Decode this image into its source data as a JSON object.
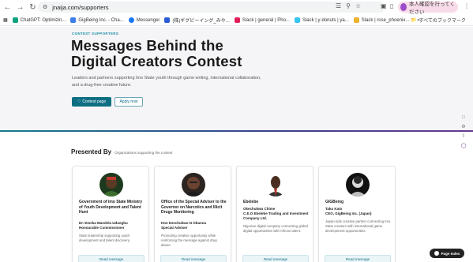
{
  "browser": {
    "url": "jnaija.com/supporters",
    "profile_label": "本人確認を行ってください",
    "bookmarks": [
      {
        "label": "ChatGPT: Optimizin...",
        "color": "#10a37f"
      },
      {
        "label": "GigBeing Inc. - Cha...",
        "color": "#3d7eea"
      },
      {
        "label": "Messenger",
        "color": "#1877f2"
      },
      {
        "label": "(株)ギグビーイング_みや...",
        "color": "#2a5bd7"
      },
      {
        "label": "Slack | general | Pho...",
        "color": "#e01e5a"
      },
      {
        "label": "Slack | y-donuts | ya...",
        "color": "#36c5f0"
      },
      {
        "label": "Slack | rose_phoenix...",
        "color": "#ecb22e"
      }
    ],
    "bookmarks_overflow": "»",
    "all_bookmarks_label": "すべてのブックマーク"
  },
  "hero": {
    "eyebrow": "CONTEST SUPPORTERS",
    "title_line1": "Messages Behind the",
    "title_line2": "Digital Creators Contest",
    "subtitle": "Leaders and partners supporting Imo State youth through game writing, international collaboration, and a drug-free creative future.",
    "primary_button": "Contest page",
    "secondary_button": "Apply now"
  },
  "presented": {
    "heading": "Presented By",
    "subheading": "Organizations supporting the contest"
  },
  "cards": [
    {
      "org": "Government of Imo State Ministry of Youth Development and Talent Hunt",
      "person": "Dr. Emeka Mandela Uduegbu",
      "role": "Honourable Commissioner",
      "desc": "State leadership supporting youth development and talent discovery.",
      "button": "Read message"
    },
    {
      "org": "Office of the Special Adviser to the Governor on Narcotics and Illicit Drugs Monitoring",
      "person": "Hon Ezechukwu N Obanna",
      "role": "Special Adviser",
      "desc": "Promoting creative opportunity while reinforcing the message against drug abuse.",
      "button": "Read message"
    },
    {
      "org": "Ebelebe",
      "person": "Okechukwu Chime",
      "role": "C.E.O Ebelebe Trading and Investment Company Ltd.",
      "desc": "Nigerian digital company connecting global digital opportunities with African talent.",
      "button": "Read message"
    },
    {
      "org": "GIGBeing",
      "person": "Taku Kato",
      "role": "CEO, GigBeing Inc. (Japan)",
      "desc": "Japan-side creative partner connecting Imo State creators with international game development opportunities.",
      "button": "Read message"
    }
  ],
  "page_index_label": "Page Index",
  "colors": {
    "accent": "#0e6f83",
    "eyebrow": "#1e8ea6",
    "hero_bg": "#f5f5f7"
  }
}
